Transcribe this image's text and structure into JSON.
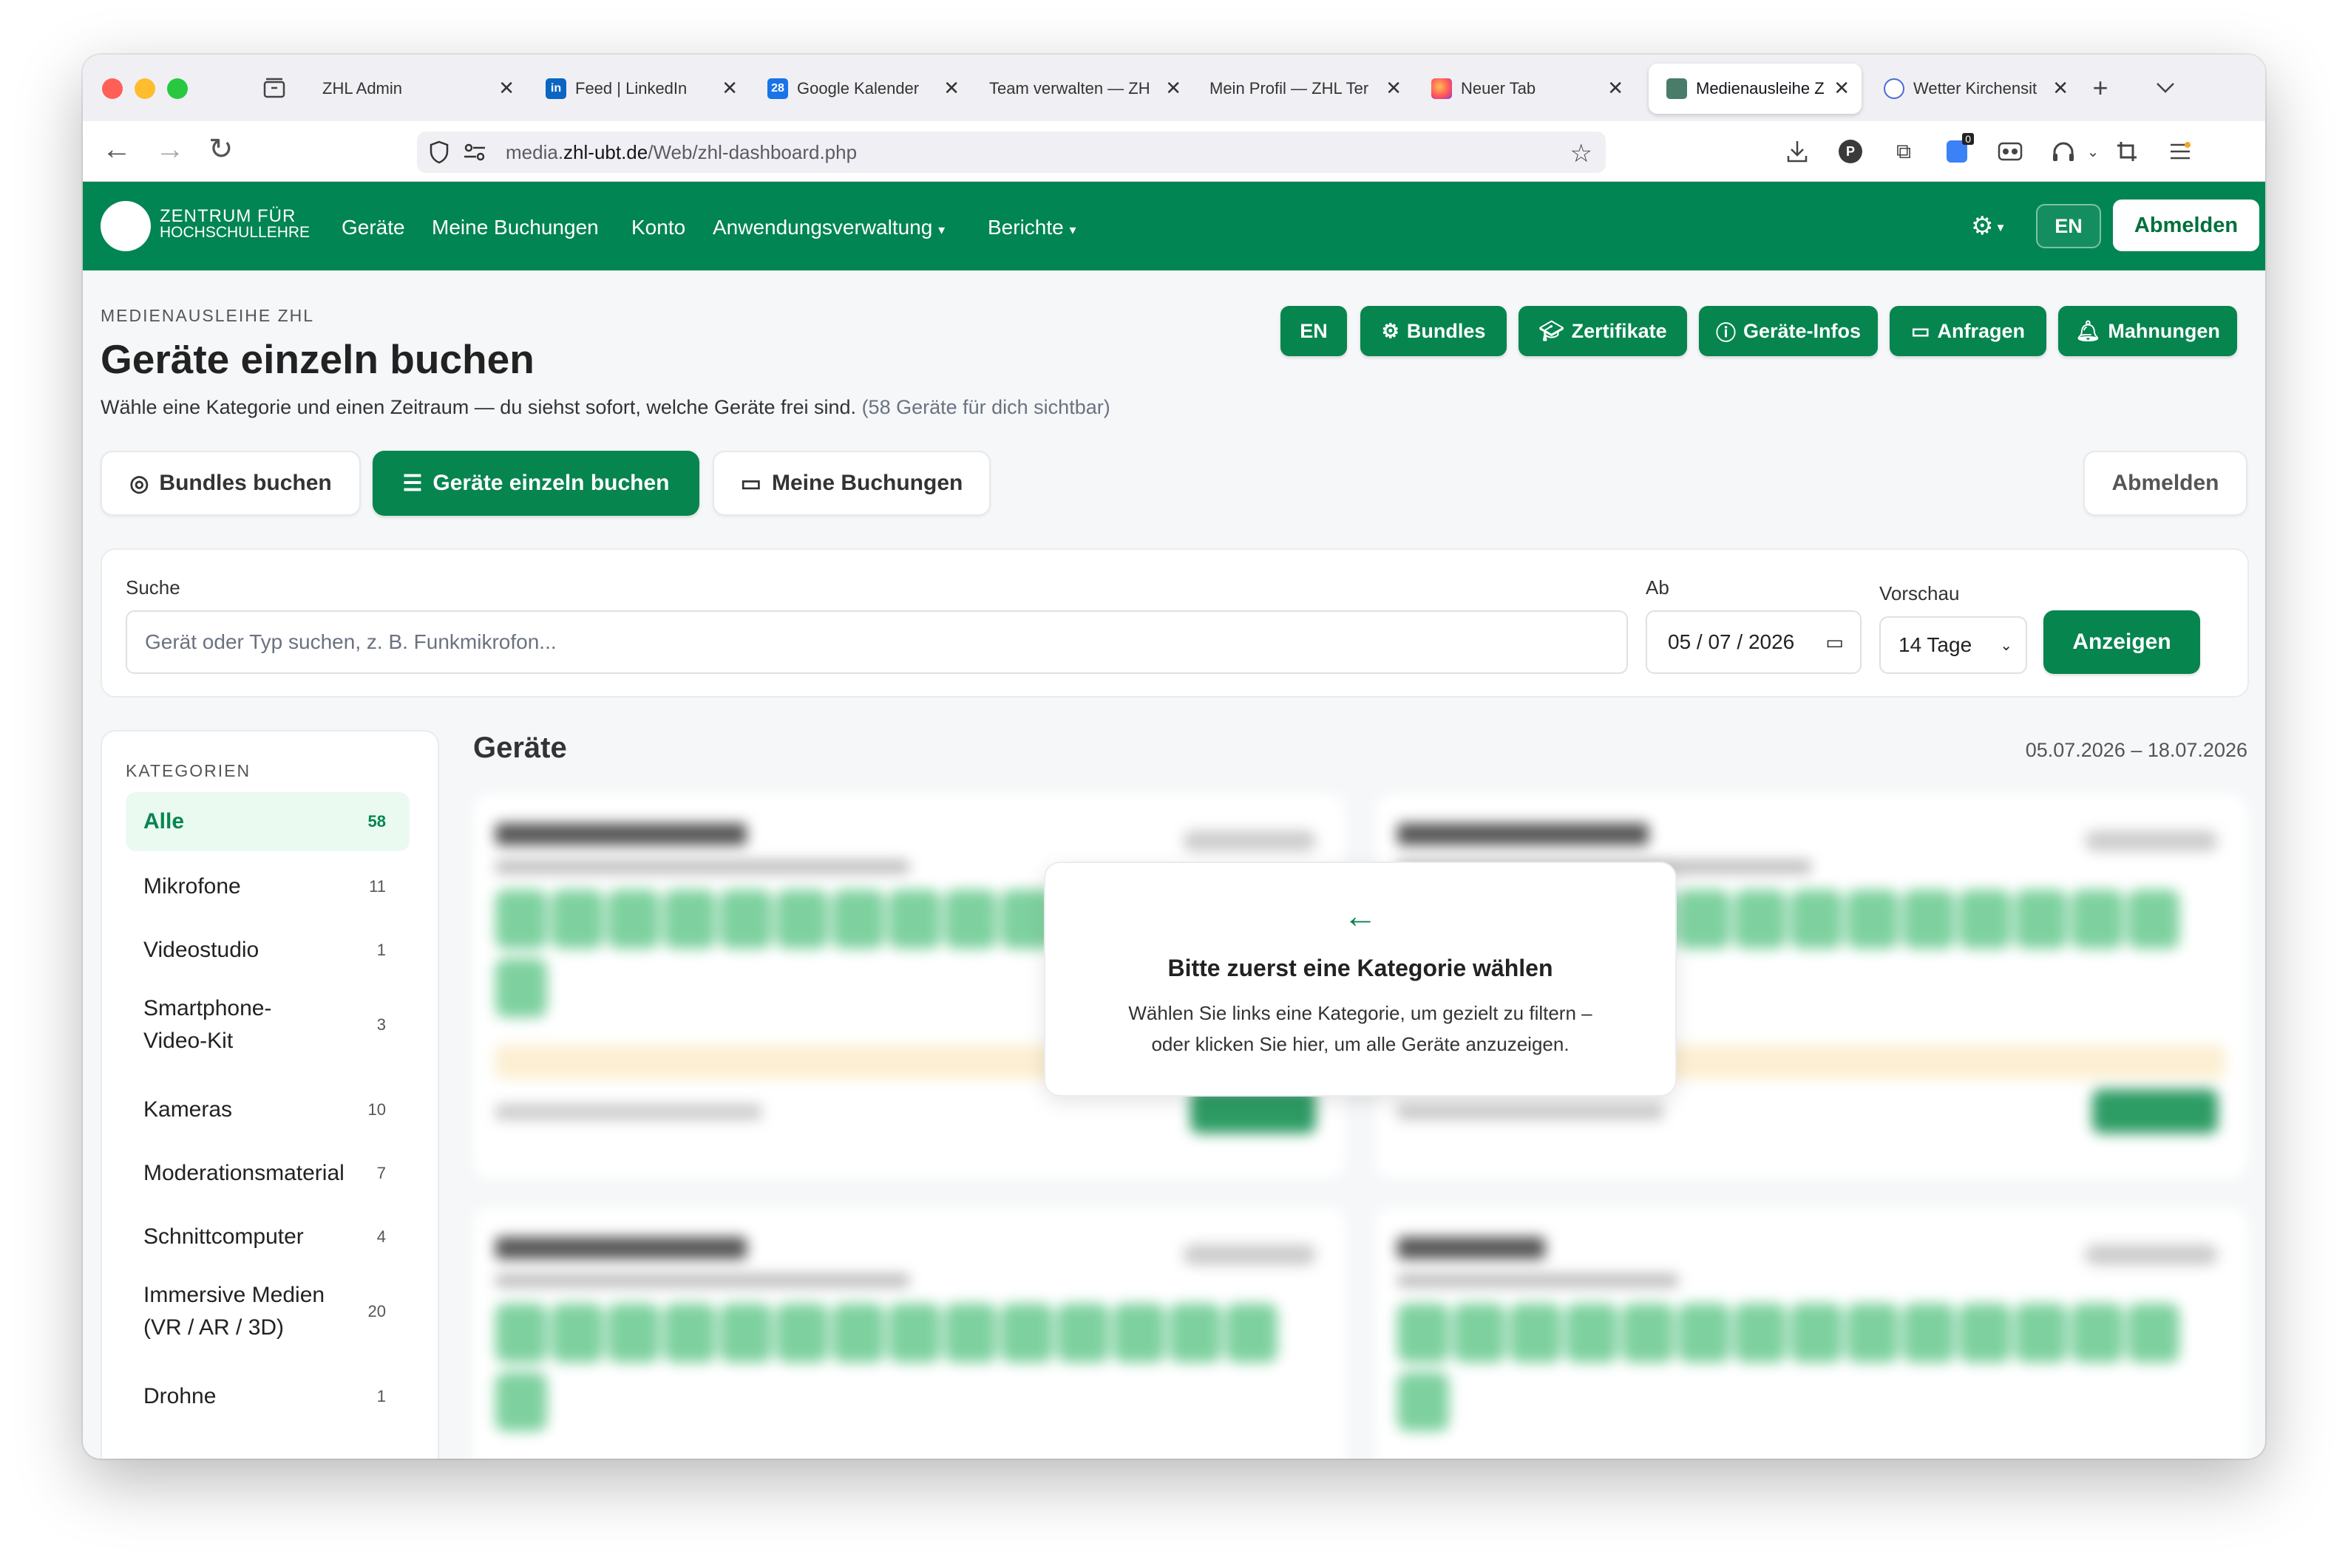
{
  "browser": {
    "tabs": [
      {
        "title": "ZHL Admin",
        "icon": "none"
      },
      {
        "title": "Feed | LinkedIn",
        "icon": "linkedin-icon"
      },
      {
        "title": "Google Kalender",
        "icon": "google-calendar-icon",
        "badge": "28"
      },
      {
        "title": "Team verwalten — ZH",
        "icon": "none"
      },
      {
        "title": "Mein Profil — ZHL Ter",
        "icon": "none"
      },
      {
        "title": "Neuer Tab",
        "icon": "firefox-icon"
      },
      {
        "title": "Medienausleihe Z",
        "icon": "media-icon",
        "active": true
      },
      {
        "title": "Wetter Kirchensit",
        "icon": "globe-icon"
      }
    ],
    "url_prefix": "media.",
    "url_domain": "zhl-ubt.de",
    "url_path": "/Web/zhl-dashboard.php",
    "notification_count": "0"
  },
  "header": {
    "logo_line1": "ZENTRUM FÜR",
    "logo_line2": "HOCHSCHULLEHRE",
    "nav": [
      "Geräte",
      "Meine Buchungen",
      "Konto",
      "Anwendungsverwaltung",
      "Berichte"
    ],
    "lang": "EN",
    "logout": "Abmelden"
  },
  "page": {
    "eyebrow": "MEDIENAUSLEIHE ZHL",
    "title": "Geräte einzeln buchen",
    "subtitle": "Wähle eine Kategorie und einen Zeitraum — du siehst sofort, welche Geräte frei sind.",
    "subtitle_count": "(58 Geräte für dich sichtbar)",
    "actions": [
      "EN",
      "Bundles",
      "Zertifikate",
      "Geräte-Infos",
      "Anfragen",
      "Mahnungen"
    ]
  },
  "modes": {
    "bundles": "Bundles buchen",
    "single": "Geräte einzeln buchen",
    "my_bookings": "Meine Buchungen",
    "logout": "Abmelden"
  },
  "filter": {
    "search_label": "Suche",
    "search_placeholder": "Gerät oder Typ suchen, z. B. Funkmikrofon...",
    "date_label": "Ab",
    "date_value": "05 / 07 / 2026",
    "preview_label": "Vorschau",
    "preview_value": "14 Tage",
    "submit": "Anzeigen"
  },
  "categories": {
    "heading": "KATEGORIEN",
    "items": [
      {
        "name": "Alle",
        "count": "58",
        "active": true
      },
      {
        "name": "Mikrofone",
        "count": "11"
      },
      {
        "name": "Videostudio",
        "count": "1"
      },
      {
        "name": "Smartphone-",
        "name2": "Video-Kit",
        "count": "3"
      },
      {
        "name": "Kameras",
        "count": "10"
      },
      {
        "name": "Moderationsmaterial",
        "count": "7"
      },
      {
        "name": "Schnittcomputer",
        "count": "4"
      },
      {
        "name": "Immersive Medien",
        "name2": "(VR / AR / 3D)",
        "count": "20"
      },
      {
        "name": "Drohne",
        "count": "1"
      }
    ]
  },
  "devices": {
    "title": "Geräte",
    "range": "05.07.2026 – 18.07.2026"
  },
  "overlay": {
    "title": "Bitte zuerst eine Kategorie wählen",
    "text1": "Wählen Sie links eine Kategorie, um gezielt zu filtern –",
    "text2": "oder klicken Sie hier, um alle Geräte anzuzeigen."
  },
  "colors": {
    "brand": "#008553",
    "accent": "#06854f",
    "active_bg": "#eafaf1"
  }
}
